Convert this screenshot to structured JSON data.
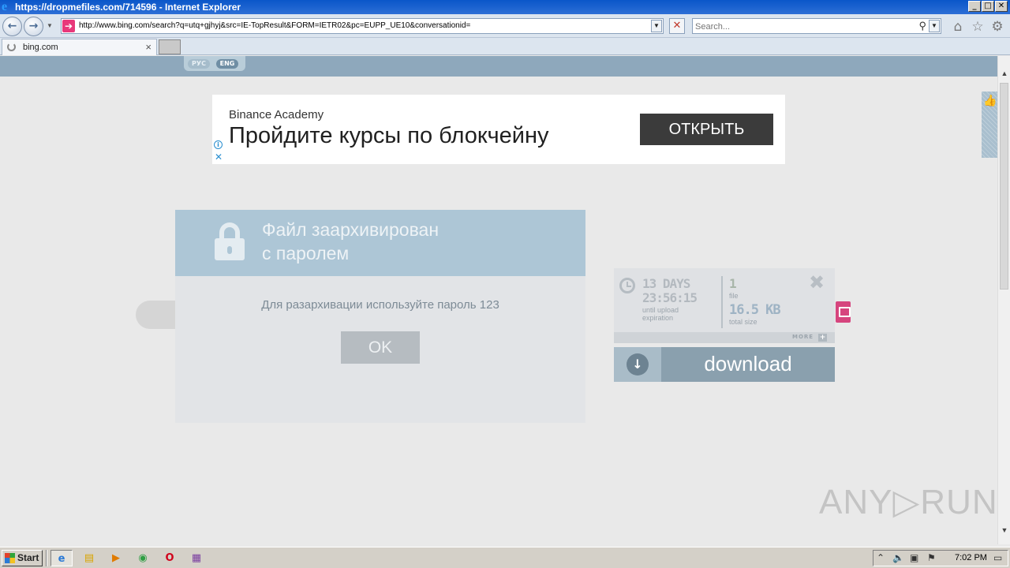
{
  "window": {
    "title": "https://dropmefiles.com/714596 - Internet Explorer",
    "buttons": [
      "_",
      "□",
      "✕"
    ]
  },
  "navbar": {
    "back_icon": "back-arrow-icon",
    "forward_icon": "forward-arrow-icon",
    "address": "http://www.bing.com/search?q=utq+gjhyj&src=IE-TopResult&FORM=IETR02&pc=EUPP_UE10&conversationid=",
    "search_placeholder": "Search..."
  },
  "tabs": [
    {
      "label": "bing.com",
      "loading": true
    }
  ],
  "page": {
    "lang": {
      "ru": "РУС",
      "en": "ENG"
    },
    "ad": {
      "brand": "Binance Academy",
      "headline": "Пройдите курсы по блокчейну",
      "cta": "ОТКРЫТЬ"
    },
    "modal": {
      "title_line1": "Файл заархивирован",
      "title_line2": "с паролем",
      "message": "Для разархивации используйте пароль 123",
      "ok": "OK"
    },
    "file_info": {
      "days": "13 DAYS",
      "time": "23:56:15",
      "until_line1": "until upload",
      "until_line2": "expiration",
      "count": "1",
      "count_label": "file",
      "size": "16.5 KB",
      "size_label": "total size",
      "more": "MORE",
      "more_plus": "+"
    },
    "download": {
      "label": "download"
    },
    "watermark": "ANY▷RUN"
  },
  "taskbar": {
    "start": "Start",
    "time": "7:02 PM"
  },
  "colors": {
    "titlebar": "#0a56c9",
    "modal_header": "#adc6d6",
    "download_bg": "#8aa0ae",
    "ad_cta": "#3b3b3b"
  }
}
